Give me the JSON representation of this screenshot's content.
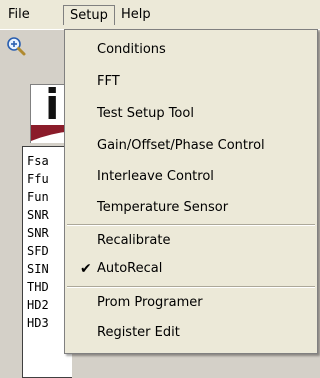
{
  "menubar": {
    "items": [
      {
        "label": "File"
      },
      {
        "label": "Setup"
      },
      {
        "label": "Help"
      }
    ]
  },
  "toolbar": {
    "zoom_icon": "zoom-in-icon"
  },
  "logo": {
    "letter": "i"
  },
  "labels": [
    "Fsa",
    "Ffu",
    "Fun",
    "SNR",
    "SNR",
    "SFD",
    "SIN",
    "THD",
    "HD2",
    "HD3"
  ],
  "setup_menu": {
    "items": [
      {
        "label": "Conditions"
      },
      {
        "label": "FFT"
      },
      {
        "label": "Test Setup Tool"
      },
      {
        "label": "Gain/Offset/Phase Control"
      },
      {
        "label": "Interleave Control"
      },
      {
        "label": "Temperature Sensor"
      },
      {
        "label": "Recalibrate"
      },
      {
        "label": "AutoRecal",
        "checked": true
      },
      {
        "label": "Prom Programer"
      },
      {
        "label": "Register Edit"
      }
    ],
    "check_glyph": "✔"
  }
}
